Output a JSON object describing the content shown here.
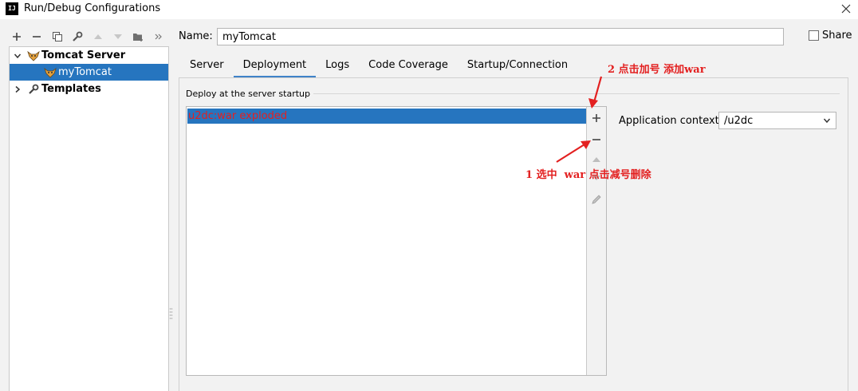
{
  "window": {
    "title": "Run/Debug Configurations",
    "logo_text": "IJ"
  },
  "tree": {
    "items": [
      {
        "label": "Tomcat Server"
      },
      {
        "label": "myTomcat"
      },
      {
        "label": "Templates"
      }
    ]
  },
  "name_field": {
    "label": "Name:",
    "value": "myTomcat"
  },
  "share": {
    "label": "Share",
    "checked": false
  },
  "tabs": [
    {
      "label": "Server"
    },
    {
      "label": "Deployment",
      "active": true
    },
    {
      "label": "Logs"
    },
    {
      "label": "Code Coverage"
    },
    {
      "label": "Startup/Connection"
    }
  ],
  "deployment": {
    "group_title": "Deploy at the server startup",
    "artifacts": [
      {
        "label": "u2dc:war exploded"
      }
    ],
    "context_label": "Application context:",
    "context_value": "/u2dc"
  },
  "annotations": {
    "add": "2 点击加号 添加war",
    "remove": "1 选中  war 点击减号删除"
  },
  "colors": {
    "selection": "#2675bf",
    "annotation": "#e32020",
    "tab_underline": "#4083c9"
  }
}
